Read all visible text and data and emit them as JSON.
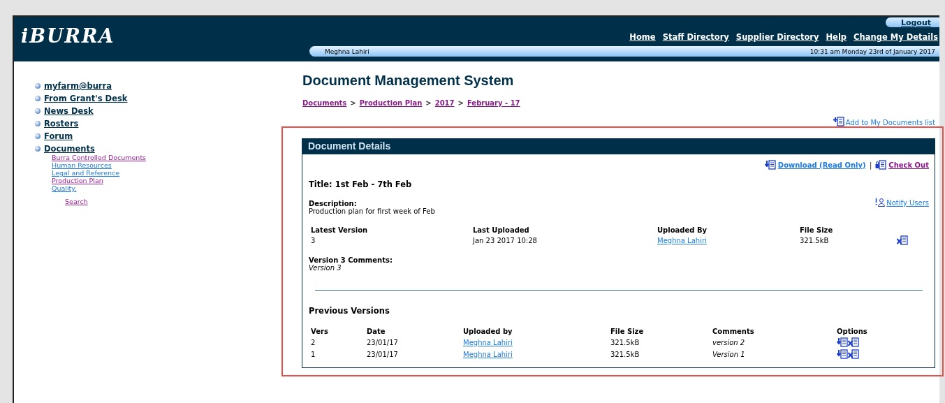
{
  "header": {
    "logo": "iBURRA",
    "logout": "Logout",
    "nav": [
      {
        "label": "Home"
      },
      {
        "label": "Staff Directory"
      },
      {
        "label": "Supplier Directory"
      },
      {
        "label": "Help"
      },
      {
        "label": "Change My Details"
      }
    ],
    "user": "Meghna Lahiri",
    "datetime": "10:31 am Monday 23rd of January 2017"
  },
  "sidebar": {
    "items": [
      {
        "label": "myfarm@burra"
      },
      {
        "label": "From Grant's Desk"
      },
      {
        "label": "News Desk"
      },
      {
        "label": "Rosters"
      },
      {
        "label": "Forum"
      },
      {
        "label": "Documents",
        "children": [
          {
            "label": "Burra Controlled Documents",
            "visited": true
          },
          {
            "label": "Human Resources",
            "visited": false
          },
          {
            "label": "Legal and Reference",
            "visited": false
          },
          {
            "label": "Production Plan",
            "visited": true
          },
          {
            "label": "Quality.",
            "visited": false
          }
        ]
      }
    ],
    "search": "Search"
  },
  "page_title": "Document Management System",
  "breadcrumb": [
    {
      "label": "Documents"
    },
    {
      "separator": ">",
      "label": "Production Plan"
    },
    {
      "separator": ">",
      "label": "2017"
    },
    {
      "separator": ">",
      "label": "February - 17"
    }
  ],
  "add_to_list": "Add to My Documents list",
  "details": {
    "heading": "Document Details",
    "download": "Download (Read Only)",
    "separator": "|",
    "checkout": "Check Out",
    "title": "Title: 1st Feb - 7th Feb",
    "description_label": "Description:",
    "description": "Production plan for first week of Feb",
    "notify": "Notify Users",
    "latest": {
      "columns": [
        "Latest Version",
        "Last Uploaded",
        "Uploaded By",
        "File Size"
      ],
      "values": [
        "3",
        "Jan 23 2017 10:28",
        "Meghna Lahiri",
        "321.5kB"
      ]
    },
    "comments_label": "Version 3 Comments:",
    "comments": "Version 3",
    "previous_heading": "Previous Versions",
    "previous": {
      "columns": [
        "Vers",
        "Date",
        "Uploaded by",
        "File Size",
        "Comments",
        "Options"
      ],
      "rows": [
        {
          "vers": "2",
          "date": "23/01/17",
          "uploaded_by": "Meghna Lahiri",
          "size": "321.5kB",
          "comment": "version 2"
        },
        {
          "vers": "1",
          "date": "23/01/17",
          "uploaded_by": "Meghna Lahiri",
          "size": "321.5kB",
          "comment": "Version 1"
        }
      ]
    }
  }
}
